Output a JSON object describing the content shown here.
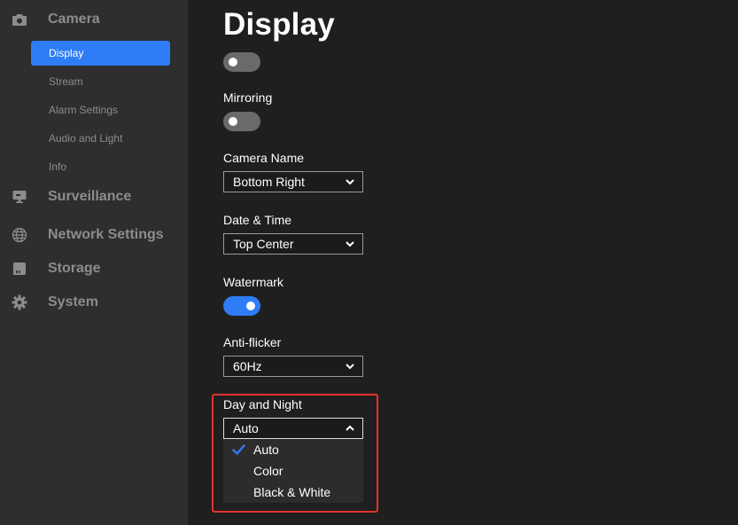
{
  "sidebar": {
    "camera": {
      "label": "Camera",
      "icon": "camera-icon"
    },
    "camera_items": [
      {
        "label": "Display",
        "active": true
      },
      {
        "label": "Stream",
        "active": false
      },
      {
        "label": "Alarm Settings",
        "active": false
      },
      {
        "label": "Audio and Light",
        "active": false
      },
      {
        "label": "Info",
        "active": false
      }
    ],
    "surveillance": {
      "label": "Surveillance",
      "icon": "monitor-icon"
    },
    "network": {
      "label": "Network Settings",
      "icon": "globe-icon"
    },
    "storage": {
      "label": "Storage",
      "icon": "storage-icon"
    },
    "system": {
      "label": "System",
      "icon": "gear-icon"
    }
  },
  "main": {
    "title": "Display",
    "top_toggle": {
      "on": false
    },
    "mirroring": {
      "label": "Mirroring",
      "on": false
    },
    "camera_name": {
      "label": "Camera Name",
      "value": "Bottom Right"
    },
    "date_time": {
      "label": "Date & Time",
      "value": "Top Center"
    },
    "watermark": {
      "label": "Watermark",
      "on": true
    },
    "anti_flicker": {
      "label": "Anti-flicker",
      "value": "60Hz"
    },
    "day_night": {
      "label": "Day and Night",
      "value": "Auto",
      "options": [
        "Auto",
        "Color",
        "Black & White"
      ],
      "selected": "Auto"
    }
  },
  "colors": {
    "accent": "#2e7cf6",
    "sidebar_bg": "#2e2e2e",
    "content_bg": "#1f1f1f",
    "highlight": "#e5322d"
  }
}
